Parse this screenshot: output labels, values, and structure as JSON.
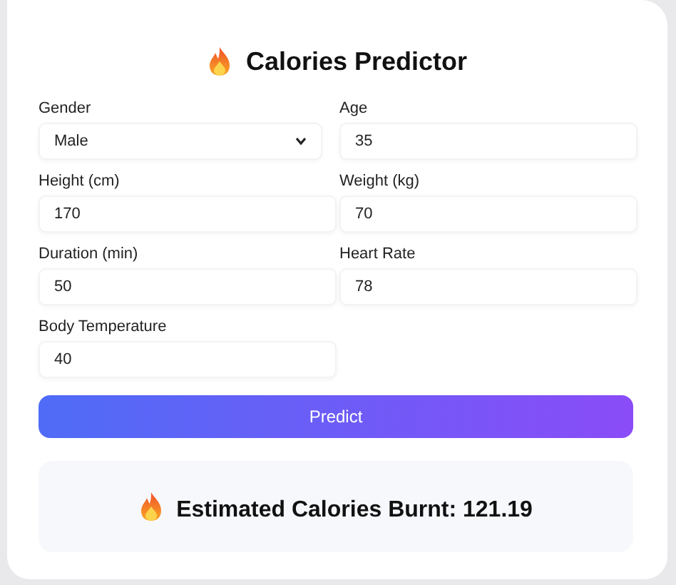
{
  "title": "Calories Predictor",
  "fields": [
    {
      "kind": "select",
      "label": "Gender",
      "value": "Male"
    },
    {
      "kind": "input",
      "label": "Age",
      "value": "35"
    },
    {
      "kind": "input",
      "label": "Height (cm)",
      "value": "170"
    },
    {
      "kind": "input",
      "label": "Weight (kg)",
      "value": "70"
    },
    {
      "kind": "input",
      "label": "Duration (min)",
      "value": "50"
    },
    {
      "kind": "input",
      "label": "Heart Rate",
      "value": "78"
    },
    {
      "kind": "input",
      "label": "Body Temperature",
      "value": "40"
    }
  ],
  "button": "Predict",
  "result": "Estimated Calories Burnt: 121.19"
}
